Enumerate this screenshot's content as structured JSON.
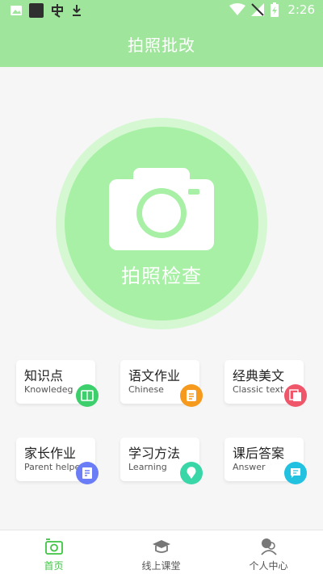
{
  "status_bar": {
    "time": "2:26",
    "icons": [
      "image-icon",
      "app-square-icon",
      "chong-app-icon",
      "download-icon",
      "wifi-icon",
      "signal-off-icon",
      "battery-charging-icon"
    ]
  },
  "header": {
    "title": "拍照批改"
  },
  "camera": {
    "label": "拍照检查",
    "icon": "camera-icon",
    "color": "#a8f0a6"
  },
  "cards": [
    {
      "cn": "知识点",
      "en": "Knowledeg",
      "icon": "book-icon",
      "color": "#3ccf6b"
    },
    {
      "cn": "语文作业",
      "en": "Chinese",
      "icon": "notebook-icon",
      "color": "#f59a1c"
    },
    {
      "cn": "经典美文",
      "en": "Classic text",
      "icon": "pages-icon",
      "color": "#f0566a"
    },
    {
      "cn": "家长作业",
      "en": "Parent helper",
      "icon": "document-icon",
      "color": "#6a7cf6"
    },
    {
      "cn": "学习方法",
      "en": "Learning",
      "icon": "location-icon",
      "color": "#39d7a8"
    },
    {
      "cn": "课后答案",
      "en": "Answer",
      "icon": "chat-icon",
      "color": "#22c1e0"
    }
  ],
  "tabs": [
    {
      "label": "首页",
      "icon": "home-camera-icon",
      "active": true
    },
    {
      "label": "线上课堂",
      "icon": "graduation-cap-icon",
      "active": false
    },
    {
      "label": "个人中心",
      "icon": "user-icon",
      "active": false
    }
  ],
  "colors": {
    "brand": "#9fe59b",
    "active_tab": "#3fc443"
  }
}
